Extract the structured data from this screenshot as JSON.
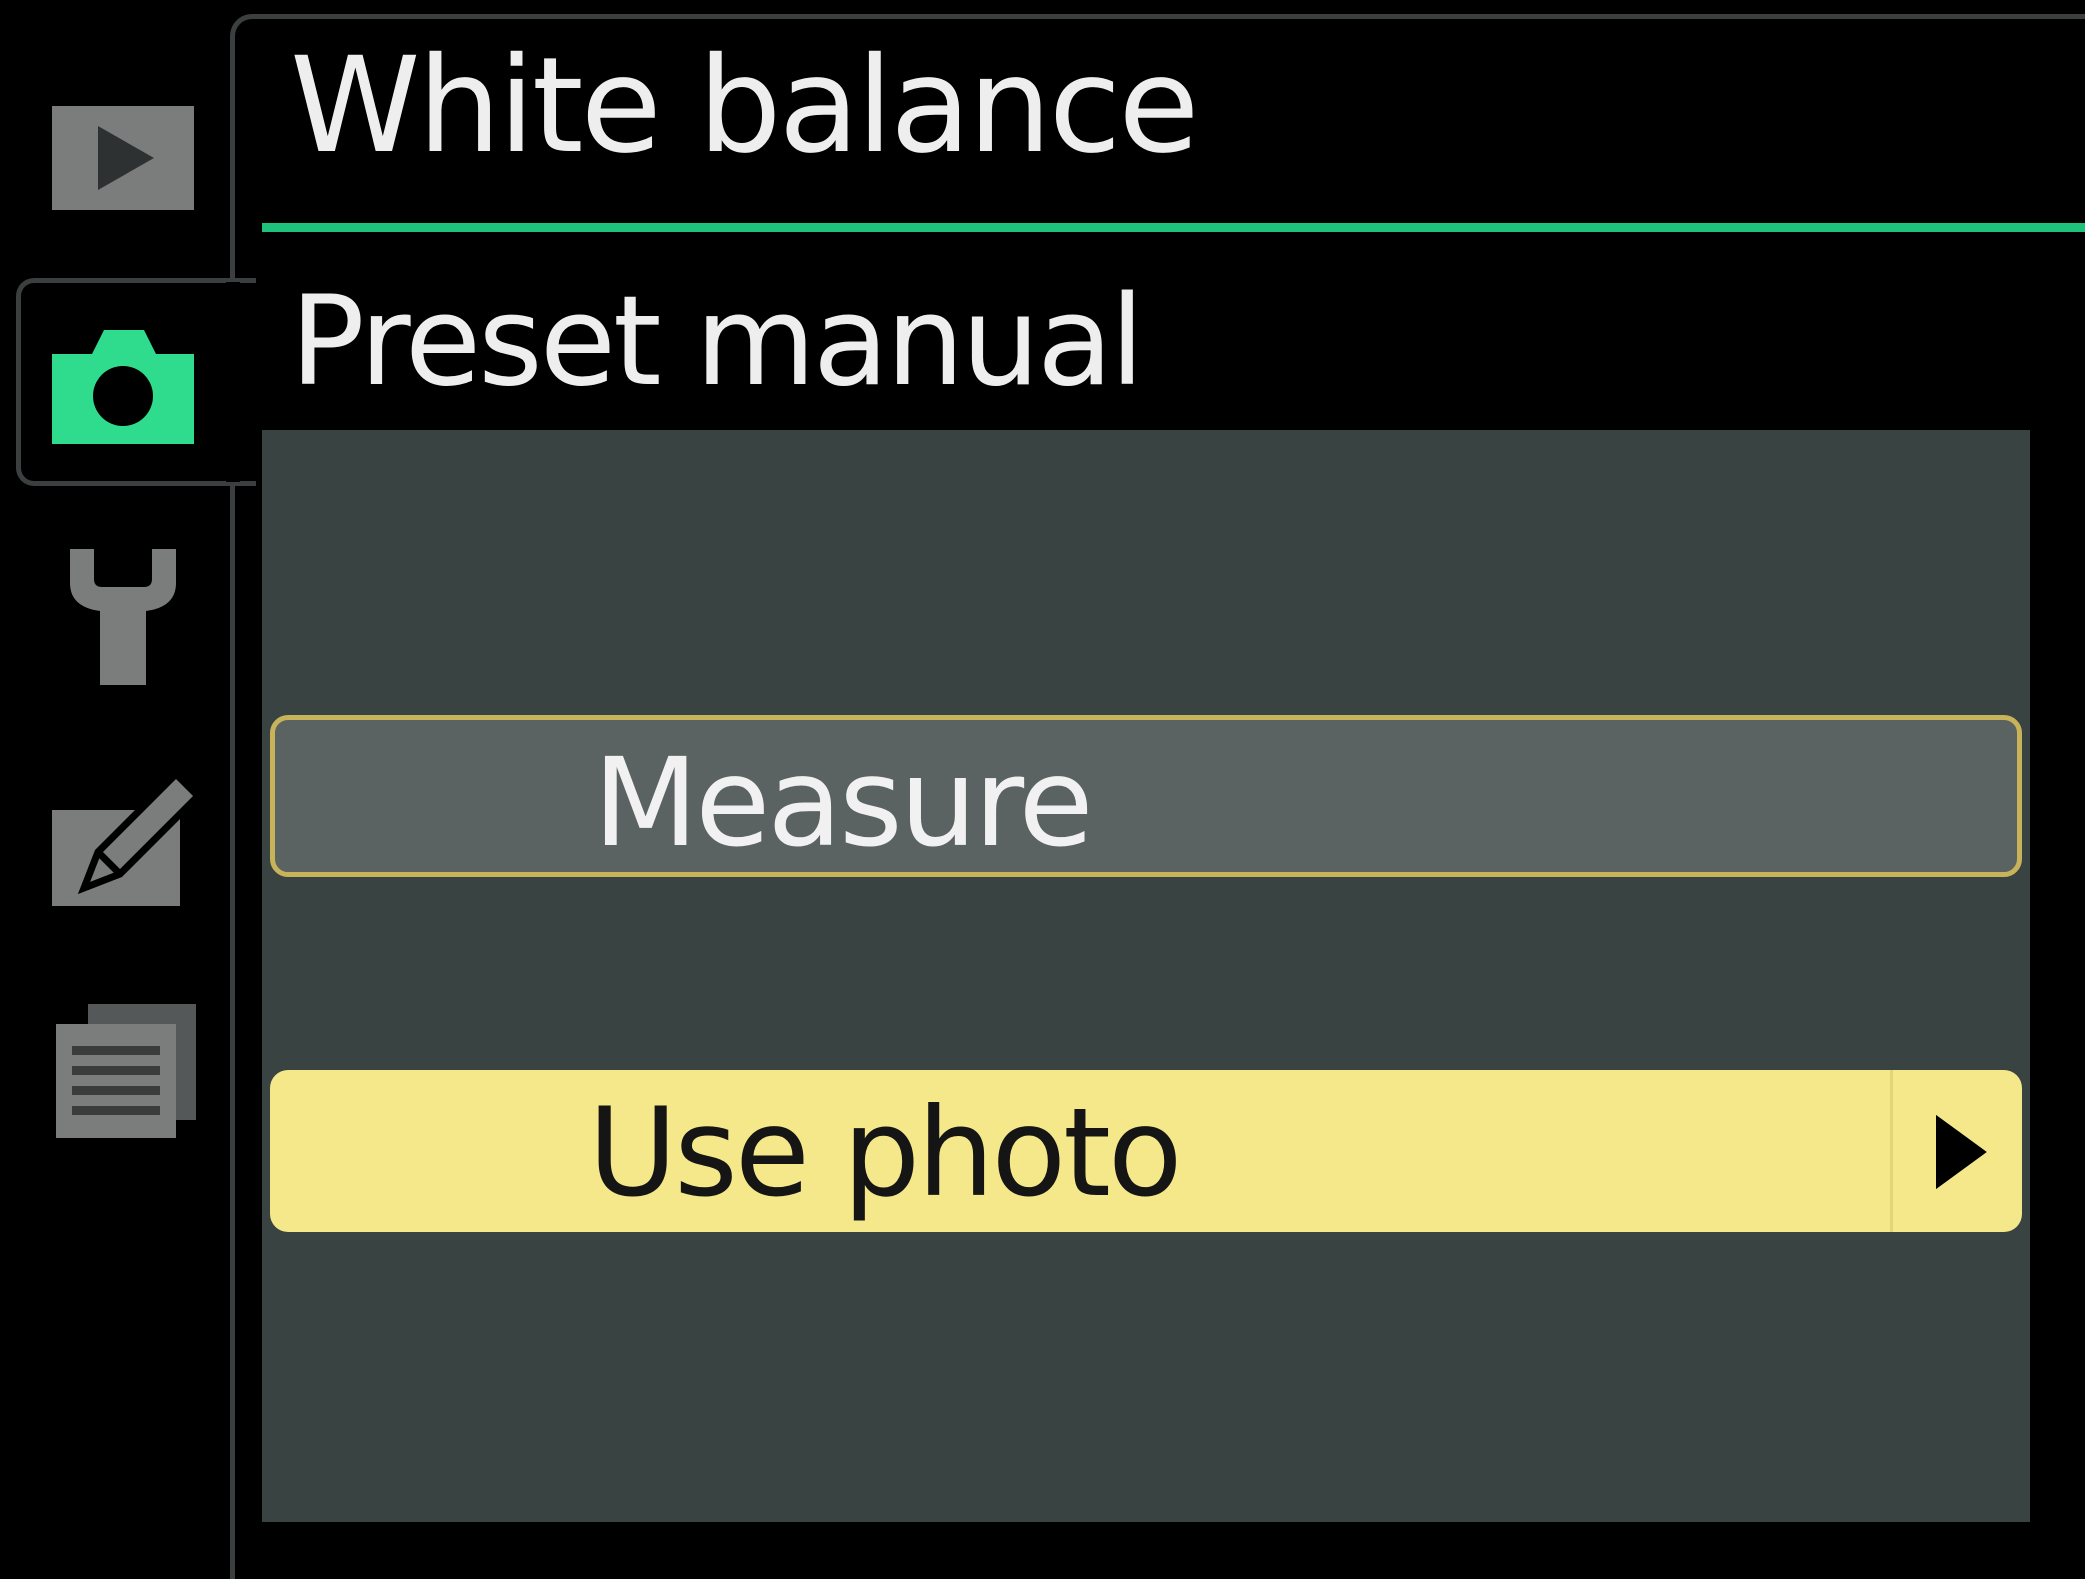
{
  "menu": {
    "title": "White balance",
    "subtitle": "Preset manual",
    "accent_color": "#1fc27a",
    "highlight_color": "#f5e88a",
    "options": [
      {
        "label": "Measure",
        "state": "outlined"
      },
      {
        "label": "Use photo",
        "state": "selected",
        "submenu_icon": "right-arrow-icon"
      }
    ]
  },
  "tabs": [
    {
      "icon": "playback-icon",
      "active": false
    },
    {
      "icon": "camera-icon",
      "active": true
    },
    {
      "icon": "wrench-icon",
      "active": false
    },
    {
      "icon": "retouch-icon",
      "active": false
    },
    {
      "icon": "recent-settings-icon",
      "active": false
    }
  ]
}
